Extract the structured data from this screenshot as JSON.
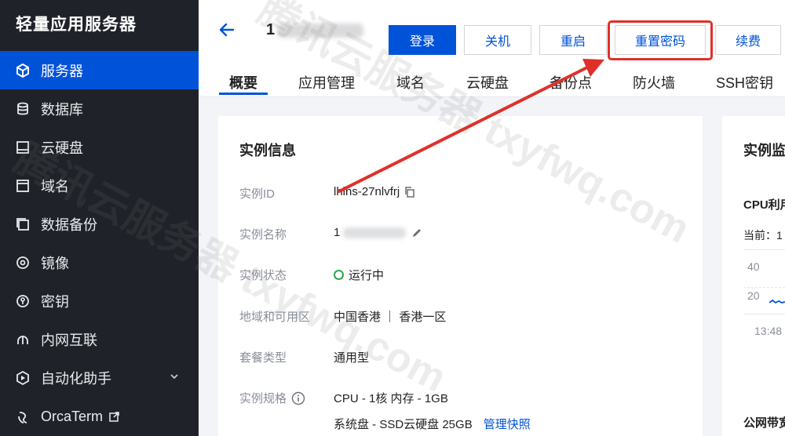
{
  "sidebar": {
    "title": "轻量应用服务器",
    "items": [
      {
        "label": "服务器",
        "icon": "cube-icon",
        "active": true
      },
      {
        "label": "数据库",
        "icon": "database-icon"
      },
      {
        "label": "云硬盘",
        "icon": "disk-icon"
      },
      {
        "label": "域名",
        "icon": "domain-icon"
      },
      {
        "label": "数据备份",
        "icon": "backup-icon"
      },
      {
        "label": "镜像",
        "icon": "image-icon"
      },
      {
        "label": "密钥",
        "icon": "key-icon"
      },
      {
        "label": "内网互联",
        "icon": "network-icon"
      },
      {
        "label": "自动化助手",
        "icon": "automation-icon"
      },
      {
        "label": "OrcaTerm",
        "icon": "orcaterm-icon"
      }
    ]
  },
  "header": {
    "title_prefix": "1",
    "buttons": {
      "login": "登录",
      "shutdown": "关机",
      "restart": "重启",
      "reset_password": "重置密码",
      "renew": "续费"
    },
    "tabs": [
      "概要",
      "应用管理",
      "域名",
      "云硬盘",
      "备份点",
      "防火墙",
      "SSH密钥"
    ]
  },
  "instance_info": {
    "title": "实例信息",
    "rows": [
      {
        "label": "实例ID",
        "value": "lhins-27nlvfrj"
      },
      {
        "label": "实例名称",
        "value": "1"
      },
      {
        "label": "实例状态",
        "value": "运行中"
      },
      {
        "label": "地域和可用区",
        "value": "中国香港 ｜ 香港一区"
      },
      {
        "label": "套餐类型",
        "value": "通用型"
      },
      {
        "label": "实例规格",
        "value": "CPU - 1核 内存 - 1GB"
      }
    ],
    "disk_value": "系统盘 - SSD云硬盘 25GB",
    "manage_snapshot": "管理快照"
  },
  "monitor": {
    "title": "实例监",
    "cpu_label": "CPU利用",
    "current_label": "当前：1",
    "axis_40": "40",
    "axis_20": "20",
    "time_label": "13:48",
    "bandwidth_label": "公网带宽"
  },
  "watermark": "腾讯云服务器 txyfwq.com",
  "colors": {
    "accent": "#0052d9",
    "sidebar_bg": "#1f2329",
    "highlight": "#e0302a",
    "status_green": "#29a74b"
  }
}
